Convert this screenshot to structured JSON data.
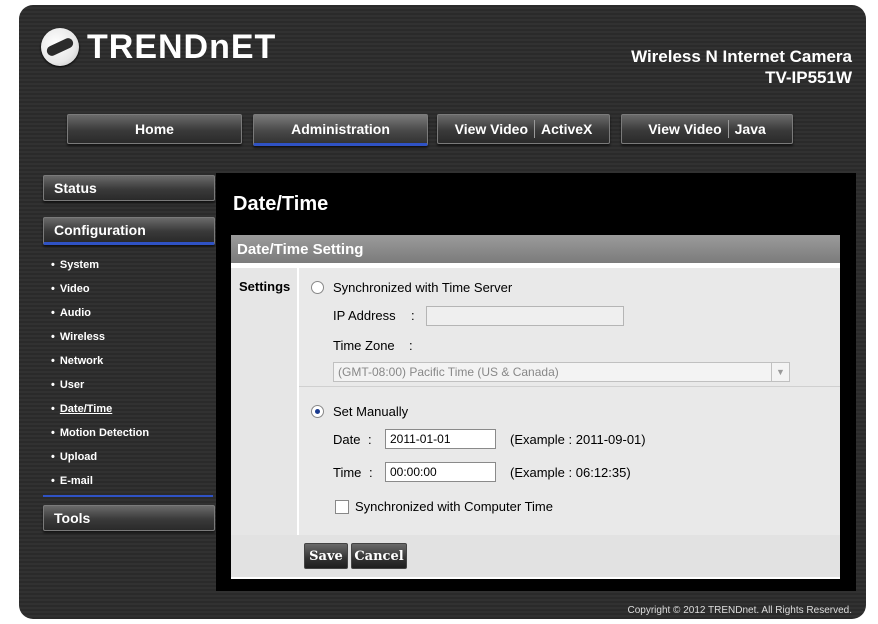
{
  "header": {
    "logo_text": "TRENDnET",
    "product_name": "Wireless N Internet Camera",
    "model": "TV-IP551W"
  },
  "nav": {
    "home": "Home",
    "administration": "Administration",
    "view_video_activex_1": "View Video",
    "view_video_activex_2": "ActiveX",
    "view_video_java_1": "View Video",
    "view_video_java_2": "Java"
  },
  "sidebar": {
    "status": "Status",
    "configuration": "Configuration",
    "items": [
      "System",
      "Video",
      "Audio",
      "Wireless",
      "Network",
      "User",
      "Date/Time",
      "Motion Detection",
      "Upload",
      "E-mail"
    ],
    "tools": "Tools"
  },
  "page": {
    "title": "Date/Time",
    "panel_title": "Date/Time Setting",
    "settings_label": "Settings"
  },
  "form": {
    "sync_server_label": "Synchronized with Time Server",
    "ip_label": "IP Address",
    "ip_value": "",
    "tz_label": "Time Zone",
    "tz_value": "(GMT-08:00) Pacific Time (US & Canada)",
    "manual_label": "Set Manually",
    "date_label": "Date",
    "date_value": "2011-01-01",
    "date_example": "(Example : 2011-09-01)",
    "time_label": "Time",
    "time_value": "00:00:00",
    "time_example": "(Example : 06:12:35)",
    "sync_computer_label": "Synchronized with Computer Time",
    "colon": ":",
    "selected_mode": "Set Manually",
    "sync_computer_checked": false
  },
  "buttons": {
    "save": "Save",
    "cancel": "Cancel"
  },
  "footer": {
    "copyright": "Copyright © 2012 TRENDnet.  All Rights Reserved."
  },
  "colors": {
    "accent": "#2f52c4",
    "panel_header": "#8a8a8a"
  }
}
